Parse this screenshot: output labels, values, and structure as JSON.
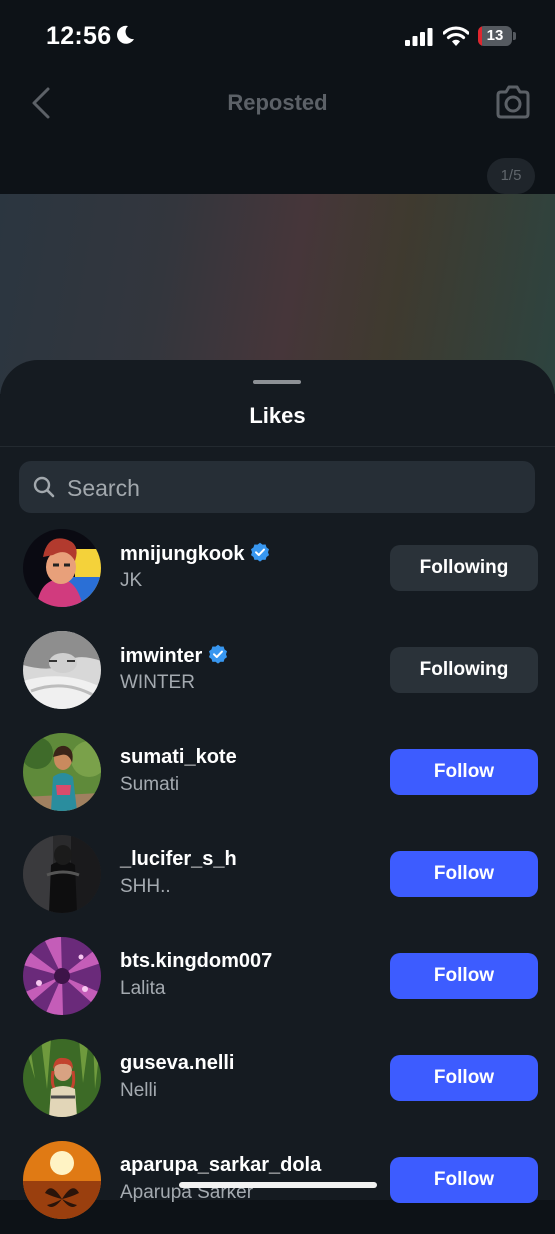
{
  "status_bar": {
    "time": "12:56",
    "battery_level": "13",
    "battery_color": "#e0262e"
  },
  "nav": {
    "title": "Reposted",
    "page_counter": "1/5"
  },
  "sheet": {
    "title": "Likes",
    "search": {
      "placeholder": "Search",
      "value": ""
    }
  },
  "likes": [
    {
      "username": "mnijungkook",
      "name": "JK",
      "verified": true,
      "button": "Following",
      "state": "following"
    },
    {
      "username": "imwinter",
      "name": "WINTER",
      "verified": true,
      "button": "Following",
      "state": "following"
    },
    {
      "username": "sumati_kote",
      "name": "Sumati",
      "verified": false,
      "button": "Follow",
      "state": "follow"
    },
    {
      "username": "_lucifer_s_h",
      "name": "SHH..",
      "verified": false,
      "button": "Follow",
      "state": "follow"
    },
    {
      "username": "bts.kingdom007",
      "name": "Lalita",
      "verified": false,
      "button": "Follow",
      "state": "follow"
    },
    {
      "username": "guseva.nelli",
      "name": "Nelli",
      "verified": false,
      "button": "Follow",
      "state": "follow"
    },
    {
      "username": "aparupa_sarkar_dola",
      "name": "Aparupa Sarker",
      "verified": false,
      "button": "Follow",
      "state": "follow"
    }
  ],
  "colors": {
    "follow_button": "#3d5cff",
    "following_button": "#2a3239",
    "verified_badge": "#3897f0",
    "sheet_background": "#151b21"
  }
}
